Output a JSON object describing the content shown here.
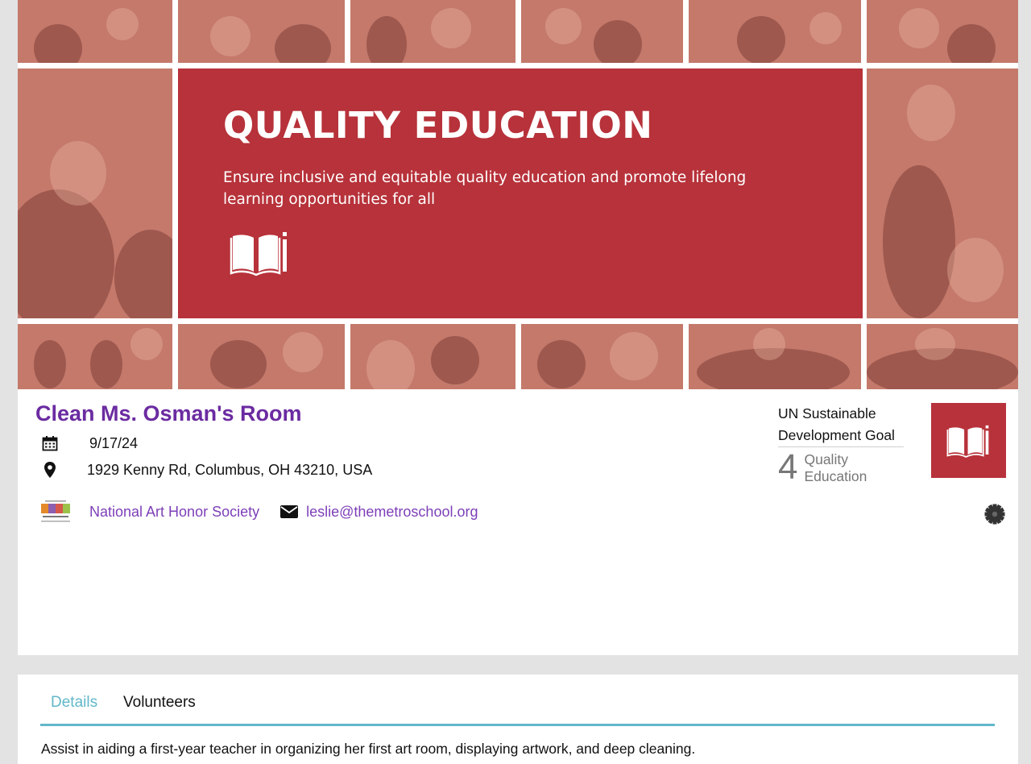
{
  "banner": {
    "title": "QUALITY EDUCATION",
    "subtitle": "Ensure inclusive and equitable quality education and promote lifelong learning opportunities for all",
    "icon": "open-book-pencil-icon",
    "accent_color": "#b7323a"
  },
  "event": {
    "title": "Clean Ms. Osman's Room",
    "date": "9/17/24",
    "location": "1929 Kenny Rd, Columbus, OH 43210, USA",
    "date_icon": "calendar-icon",
    "location_icon": "map-marker-icon"
  },
  "organization": {
    "name": "National Art Honor Society",
    "email": "leslie@themetroschool.org",
    "logo_icon": "national-art-honor-society-logo",
    "email_icon": "envelope-icon"
  },
  "sdg": {
    "heading": "UN Sustainable Development Goal",
    "number": "4",
    "name": "Quality Education",
    "icon": "open-book-pencil-icon"
  },
  "settings": {
    "icon": "gear-icon"
  },
  "tabs": [
    {
      "label": "Details",
      "active": true
    },
    {
      "label": "Volunteers",
      "active": false
    }
  ],
  "details": {
    "description": "Assist in aiding a first-year teacher in organizing her first art room, displaying artwork, and deep cleaning."
  },
  "colors": {
    "event_title": "#6b2ba1",
    "link": "#7d3fb8",
    "tab_active": "#62b7c9",
    "page_background": "#e3e3e3"
  }
}
